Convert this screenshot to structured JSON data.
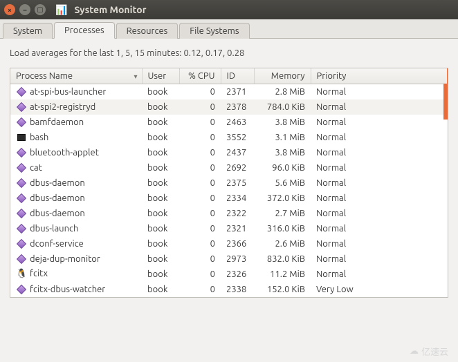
{
  "window": {
    "title": "System Monitor",
    "controls": {
      "close": "×",
      "minimize": "–",
      "maximize": "▢"
    }
  },
  "tabs": [
    {
      "id": "system",
      "label": "System",
      "active": false
    },
    {
      "id": "processes",
      "label": "Processes",
      "active": true
    },
    {
      "id": "resources",
      "label": "Resources",
      "active": false
    },
    {
      "id": "filesystems",
      "label": "File Systems",
      "active": false
    }
  ],
  "load_averages": {
    "text": "Load averages for the last 1, 5, 15 minutes: 0.12, 0.17, 0.28"
  },
  "columns": {
    "name": "Process Name",
    "user": "User",
    "cpu": "% CPU",
    "id": "ID",
    "memory": "Memory",
    "priority": "Priority"
  },
  "sort": {
    "column": "name",
    "direction": "asc",
    "indicator": "▾"
  },
  "processes": [
    {
      "icon": "diamond",
      "name": "at-spi-bus-launcher",
      "user": "book",
      "cpu": "0",
      "id": "2371",
      "memory": "2.8 MiB",
      "priority": "Normal",
      "highlight": false
    },
    {
      "icon": "diamond",
      "name": "at-spi2-registryd",
      "user": "book",
      "cpu": "0",
      "id": "2378",
      "memory": "784.0 KiB",
      "priority": "Normal",
      "highlight": true
    },
    {
      "icon": "diamond",
      "name": "bamfdaemon",
      "user": "book",
      "cpu": "0",
      "id": "2463",
      "memory": "3.8 MiB",
      "priority": "Normal",
      "highlight": false
    },
    {
      "icon": "terminal",
      "name": "bash",
      "user": "book",
      "cpu": "0",
      "id": "3552",
      "memory": "3.1 MiB",
      "priority": "Normal",
      "highlight": false
    },
    {
      "icon": "diamond",
      "name": "bluetooth-applet",
      "user": "book",
      "cpu": "0",
      "id": "2437",
      "memory": "3.8 MiB",
      "priority": "Normal",
      "highlight": false
    },
    {
      "icon": "diamond",
      "name": "cat",
      "user": "book",
      "cpu": "0",
      "id": "2692",
      "memory": "96.0 KiB",
      "priority": "Normal",
      "highlight": false
    },
    {
      "icon": "diamond",
      "name": "dbus-daemon",
      "user": "book",
      "cpu": "0",
      "id": "2375",
      "memory": "5.6 MiB",
      "priority": "Normal",
      "highlight": false
    },
    {
      "icon": "diamond",
      "name": "dbus-daemon",
      "user": "book",
      "cpu": "0",
      "id": "2334",
      "memory": "372.0 KiB",
      "priority": "Normal",
      "highlight": false
    },
    {
      "icon": "diamond",
      "name": "dbus-daemon",
      "user": "book",
      "cpu": "0",
      "id": "2322",
      "memory": "2.7 MiB",
      "priority": "Normal",
      "highlight": false
    },
    {
      "icon": "diamond",
      "name": "dbus-launch",
      "user": "book",
      "cpu": "0",
      "id": "2321",
      "memory": "316.0 KiB",
      "priority": "Normal",
      "highlight": false
    },
    {
      "icon": "diamond",
      "name": "dconf-service",
      "user": "book",
      "cpu": "0",
      "id": "2366",
      "memory": "2.6 MiB",
      "priority": "Normal",
      "highlight": false
    },
    {
      "icon": "diamond",
      "name": "deja-dup-monitor",
      "user": "book",
      "cpu": "0",
      "id": "2973",
      "memory": "832.0 KiB",
      "priority": "Normal",
      "highlight": false
    },
    {
      "icon": "penguin",
      "name": "fcitx",
      "user": "book",
      "cpu": "0",
      "id": "2326",
      "memory": "11.2 MiB",
      "priority": "Normal",
      "highlight": false
    },
    {
      "icon": "diamond",
      "name": "fcitx-dbus-watcher",
      "user": "book",
      "cpu": "0",
      "id": "2338",
      "memory": "152.0 KiB",
      "priority": "Very Low",
      "highlight": false
    }
  ],
  "watermark": {
    "text": "亿速云",
    "icon": "cloud"
  }
}
